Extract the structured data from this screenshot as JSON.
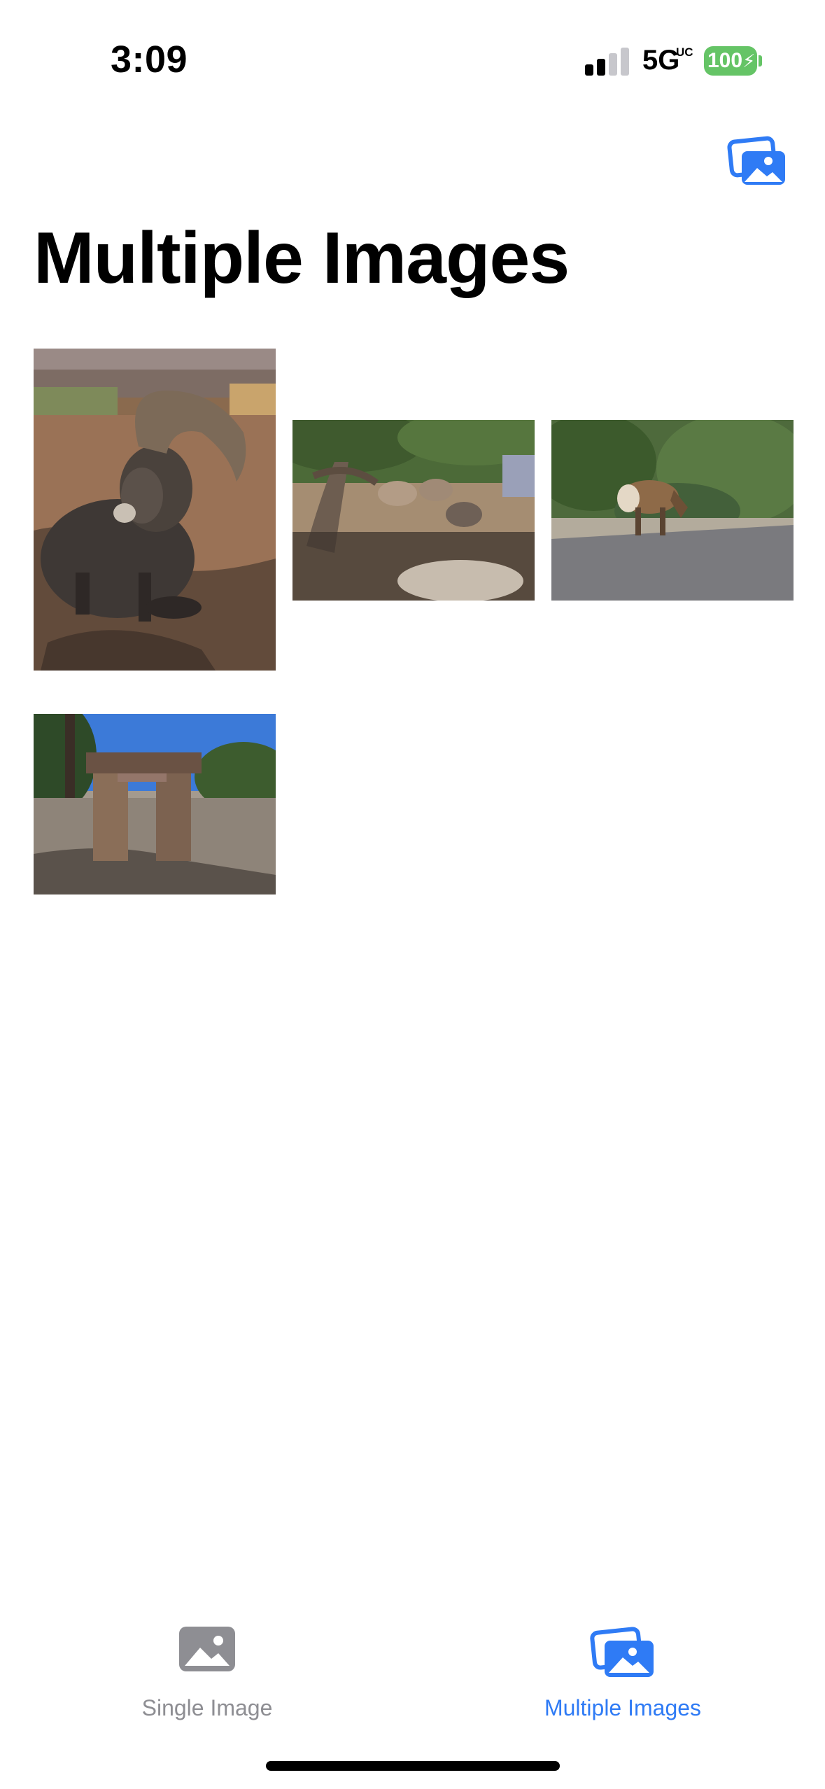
{
  "status_bar": {
    "time": "3:09",
    "network": "5G",
    "network_sub": "UC",
    "battery": "100",
    "signal_bars_active": 2,
    "signal_bars_total": 4
  },
  "nav": {
    "photos_button_icon": "photo-stack-icon"
  },
  "title": "Multiple Images",
  "photos": [
    {
      "subject": "bighorn-ram-resting",
      "icon": "photo"
    },
    {
      "subject": "sheep-under-tree",
      "icon": "photo"
    },
    {
      "subject": "elk-by-road",
      "icon": "photo"
    },
    {
      "subject": "stone-archway",
      "icon": "photo"
    }
  ],
  "tab_bar": {
    "tabs": [
      {
        "label": "Single Image",
        "icon": "photo-icon",
        "selected": false
      },
      {
        "label": "Multiple Images",
        "icon": "photo-stack-icon",
        "selected": true
      }
    ]
  },
  "colors": {
    "accent": "#2F7BF5",
    "inactive": "#8E8E93",
    "battery_green": "#65C466",
    "signal_inactive": "#C7C7CC",
    "text": "#000000"
  }
}
